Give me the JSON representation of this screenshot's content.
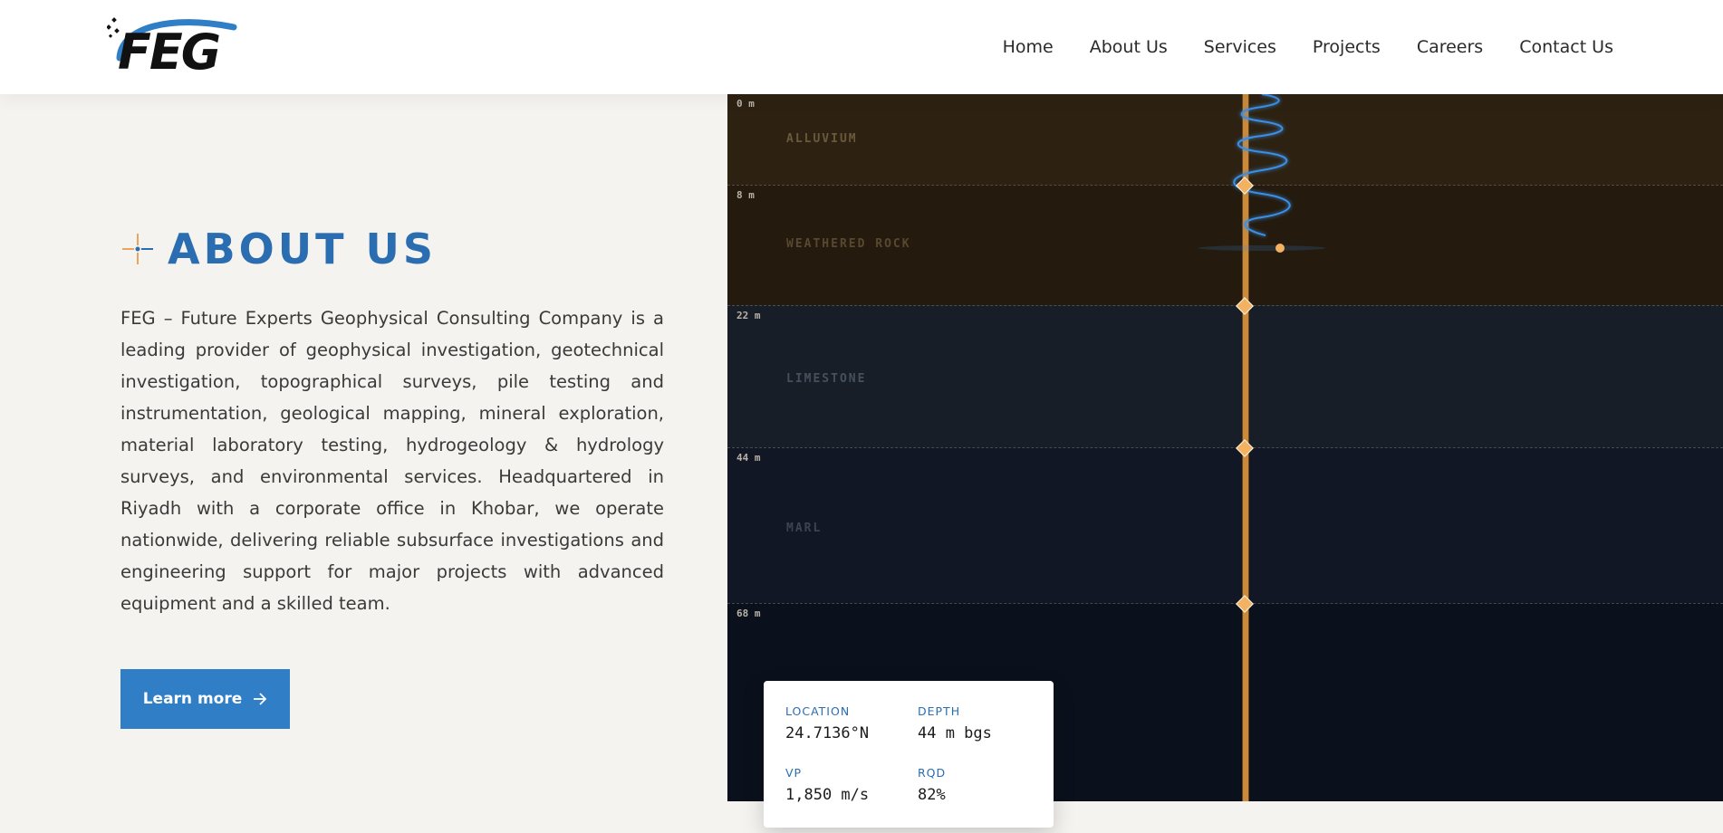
{
  "brand": {
    "logo_text": "FEG"
  },
  "nav": {
    "items": [
      {
        "label": "Home"
      },
      {
        "label": "About Us"
      },
      {
        "label": "Services"
      },
      {
        "label": "Projects"
      },
      {
        "label": "Careers"
      },
      {
        "label": "Contact Us"
      }
    ]
  },
  "about": {
    "title": "ABOUT US",
    "paragraph": "FEG – Future Experts Geophysical Consulting Company is a leading provider of geophysical investigation, geotechnical investigation, topographical surveys, pile testing and instrumentation, geological mapping, mineral exploration, material laboratory testing, hydrogeology & hydrology surveys, and environmental services. Headquartered in Riyadh with a corporate office in Khobar, we operate nationwide, delivering reliable subsurface investigations and engineering support for major projects with advanced equipment and a skilled team.",
    "button_label": "Learn more",
    "button_icon": "arrow-right-icon"
  },
  "geo": {
    "layers": [
      {
        "name": "ALLUVIUM",
        "top_depth": "0 m",
        "color": "#2d2212",
        "label_color": "#6a5a3c"
      },
      {
        "name": "WEATHERED ROCK",
        "top_depth": "8 m",
        "color": "#241a0e",
        "label_color": "#57482f"
      },
      {
        "name": "LIMESTONE",
        "top_depth": "22 m",
        "color": "#171e28",
        "label_color": "#46505c"
      },
      {
        "name": "MARL",
        "top_depth": "44 m",
        "color": "#111724",
        "label_color": "#3c4454"
      },
      {
        "name": "",
        "top_depth": "68 m",
        "color": "#0b111c",
        "label_color": "#3c4454"
      }
    ],
    "accent_color": "#f3b262",
    "wave_color": "#3a8fe6"
  },
  "info_card": {
    "items": [
      {
        "label": "LOCATION",
        "value": "24.7136°N"
      },
      {
        "label": "DEPTH",
        "value": "44 m bgs"
      },
      {
        "label": "VP",
        "value": "1,850 m/s"
      },
      {
        "label": "RQD",
        "value": "82%"
      }
    ]
  }
}
